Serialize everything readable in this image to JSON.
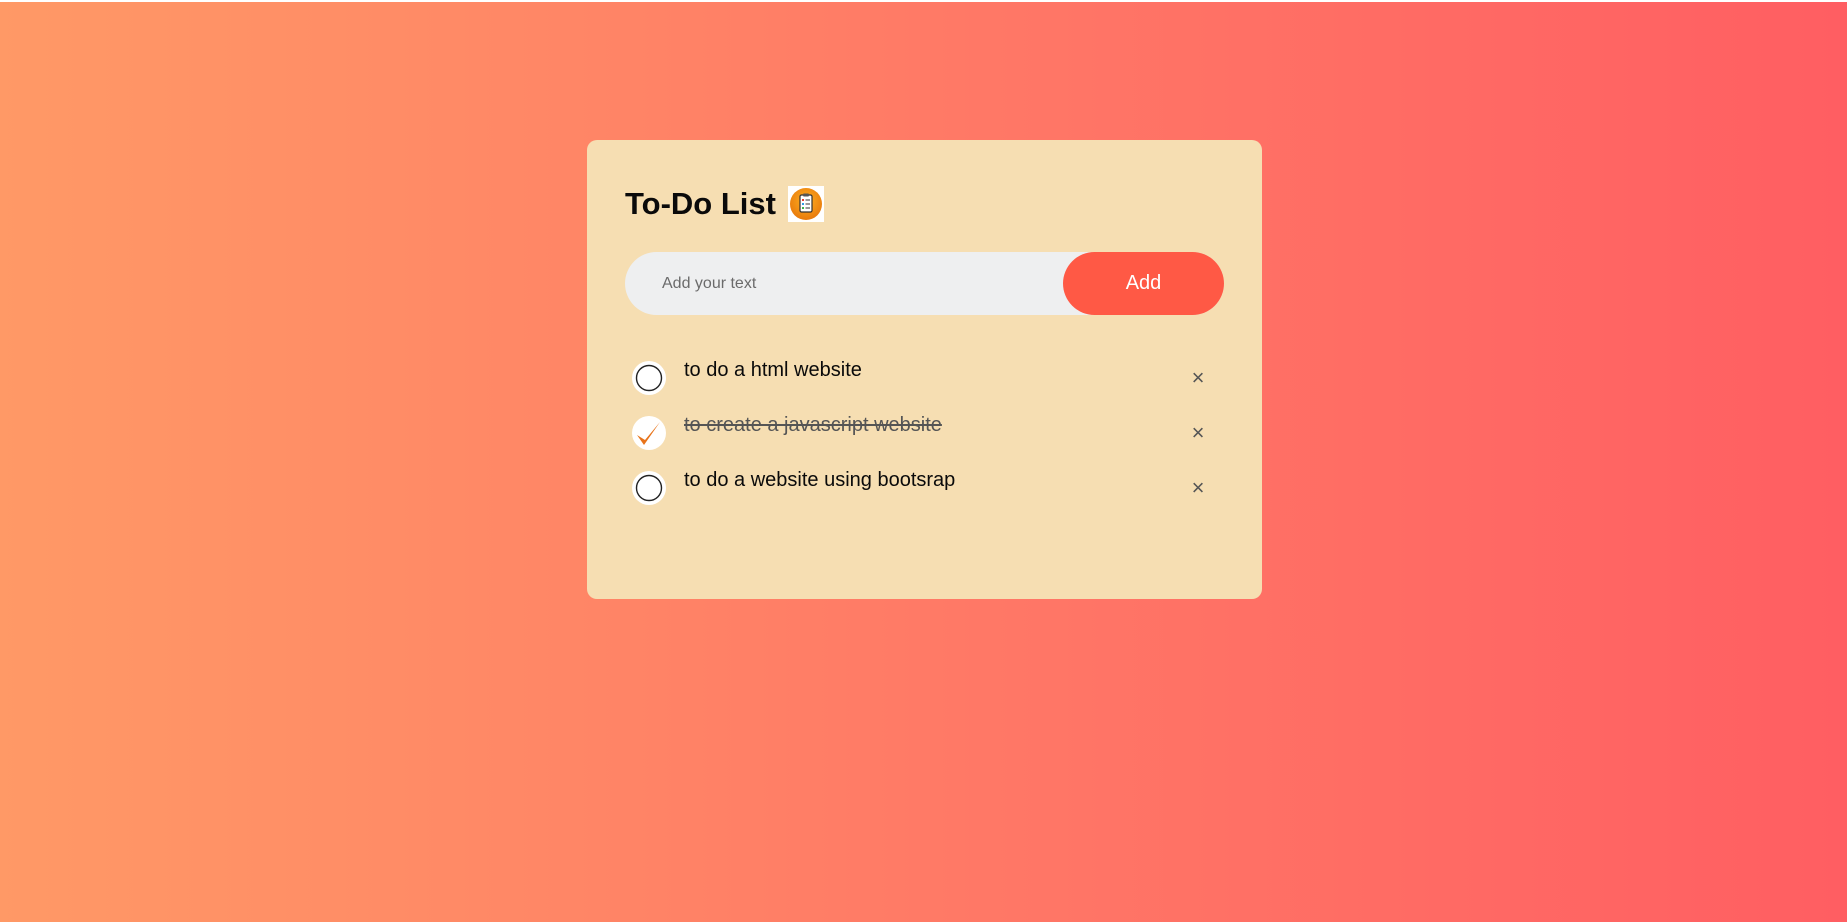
{
  "app": {
    "title": "To-Do List",
    "title_icon": "clipboard-checklist-icon"
  },
  "input": {
    "placeholder": "Add your text",
    "value": "",
    "add_label": "Add"
  },
  "tasks": [
    {
      "text": "to do a html website",
      "checked": false
    },
    {
      "text": "to create a javascript website",
      "checked": true
    },
    {
      "text": "to do a website using bootsrap",
      "checked": false
    }
  ],
  "delete_glyph": "×",
  "colors": {
    "accent": "#ff5945",
    "card": "#f6deb2",
    "check": "#e8731a",
    "gradient_start": "#ff9966",
    "gradient_end": "#ff5e62"
  }
}
